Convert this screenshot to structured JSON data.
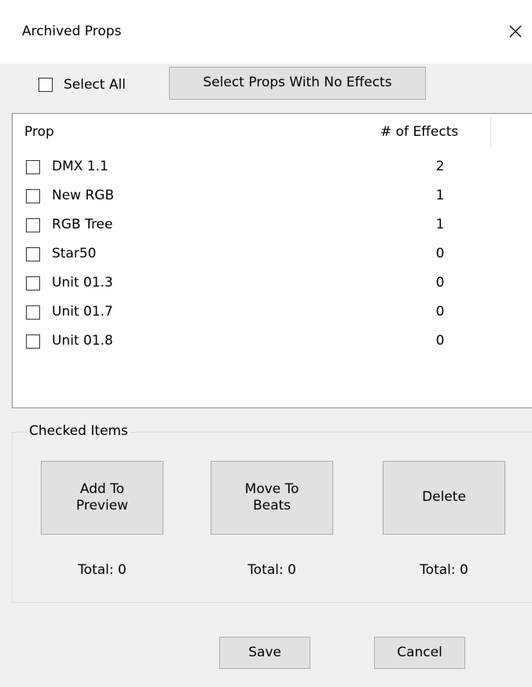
{
  "window": {
    "title": "Archived Props",
    "close_icon": "close-icon"
  },
  "top": {
    "select_all_label": "Select All",
    "select_all_checked": false,
    "select_no_effects_label": "Select Props With No Effects"
  },
  "list": {
    "columns": [
      "Prop",
      "# of Effects"
    ],
    "rows": [
      {
        "name": "DMX 1.1",
        "effects": "2",
        "checked": false
      },
      {
        "name": "New RGB",
        "effects": "1",
        "checked": false
      },
      {
        "name": "RGB Tree",
        "effects": "1",
        "checked": false
      },
      {
        "name": "Star50",
        "effects": "0",
        "checked": false
      },
      {
        "name": "Unit 01.3",
        "effects": "0",
        "checked": false
      },
      {
        "name": "Unit 01.7",
        "effects": "0",
        "checked": false
      },
      {
        "name": "Unit 01.8",
        "effects": "0",
        "checked": false
      }
    ]
  },
  "checked_items": {
    "group_label": "Checked Items",
    "actions": [
      {
        "label_line1": "Add To",
        "label_line2": "Preview",
        "total": "Total: 0"
      },
      {
        "label_line1": "Move To",
        "label_line2": "Beats",
        "total": "Total: 0"
      },
      {
        "label_line1": "Delete",
        "label_line2": "",
        "total": "Total: 0"
      }
    ]
  },
  "footer": {
    "save_label": "Save",
    "cancel_label": "Cancel"
  }
}
